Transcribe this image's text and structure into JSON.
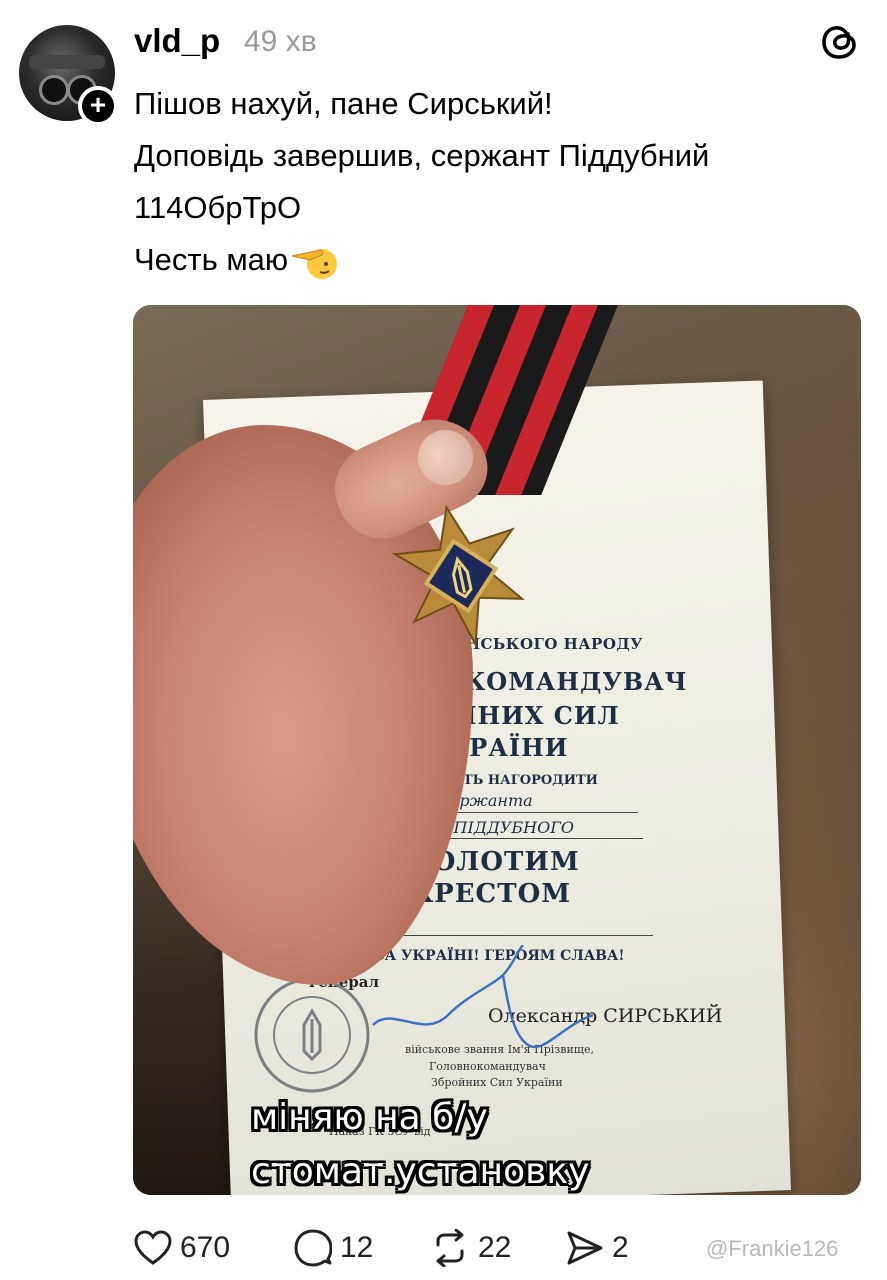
{
  "post": {
    "username": "vld_p",
    "time_ago": "49 хв",
    "follow_symbol": "+",
    "text_lines": [
      "Пішов нахуй, пане Сирський!",
      "Доповідь завершив, сержант Піддубний",
      "114ОбрТрО",
      "Честь маю"
    ],
    "emoji": "saluting-face"
  },
  "image": {
    "description_icon": "photo",
    "document_lines": [
      "ІМЕНЕМ УКРАЇНСЬКОГО НАРОДУ",
      "ГОЛОВНОКОМАНДУВАЧ",
      "ЗБРОЙНИХ СИЛ",
      "УКРАЇНИ",
      "МАЄ ЧЕСТЬ НАГОРОДИТИ",
      "сержанта",
      "Владислава ПІДДУБНОГО",
      "ЗОЛОТИМ",
      "ХРЕСТОМ",
      "СЛАВА УКРАЇНІ! ГЕРОЯМ СЛАВА!",
      "генерал",
      "Олександр СИРСЬКИЙ",
      "військове звання Ім'я Прізвище,",
      "Головнокомандувач",
      "Збройних Сил України",
      "Наказ ГК ЗСУ від"
    ],
    "caption_lines": [
      "міняю на б/у",
      "стомат.установку"
    ]
  },
  "actions": {
    "likes": "670",
    "replies": "12",
    "reposts": "22",
    "shares": "2"
  },
  "watermark": "@Frankie126",
  "colors": {
    "text": "#000000",
    "muted": "#9a9a9a",
    "ribbon_red": "#c8252c",
    "document_ink": "#1d2f45"
  }
}
